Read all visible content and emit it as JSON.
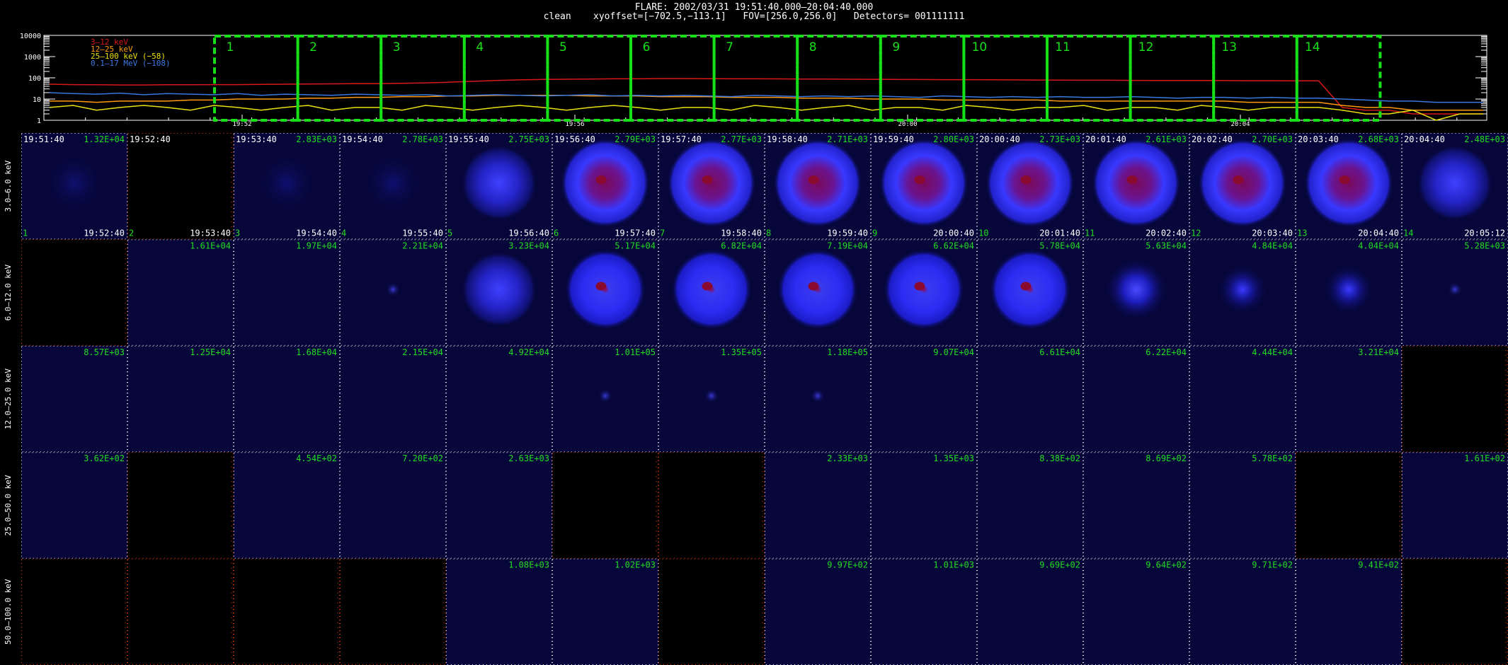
{
  "header": {
    "line1": "FLARE: 2002/03/31 19:51:40.000–20:04:40.000",
    "line2": "clean    xyoffset=[−702.5,−113.1]   FOV=[256.0,256.0]   Detectors= 001111111"
  },
  "colors": {
    "band1": "#d81818",
    "band2": "#ff9a10",
    "band3": "#e8e010",
    "band4": "#3a78e0",
    "interval_box": "#18e018",
    "tick_white": "#ffffff",
    "tick_red": "#e84010",
    "label_green": "#22dd22",
    "empty_panel": "#000000",
    "map_background": "#06063a"
  },
  "chart_data": [
    {
      "type": "line",
      "yscale": "log",
      "yticks": [
        "10000",
        "1000",
        "100",
        "10",
        "1"
      ],
      "ylim": [
        1,
        10000
      ],
      "xtick_labels": [
        "19:52",
        "19:56",
        "20:00",
        "20:04"
      ],
      "legend_placement": "top-left",
      "series": [
        {
          "name": "3–12 keV",
          "color_key": "band1",
          "values": [
            50,
            48,
            47,
            46,
            46,
            47,
            47,
            48,
            48,
            49,
            50,
            51,
            52,
            53,
            53,
            55,
            58,
            62,
            68,
            75,
            80,
            84,
            86,
            88,
            90,
            90,
            92,
            92,
            91,
            90,
            90,
            89,
            88,
            87,
            86,
            85,
            84,
            83,
            82,
            82,
            81,
            80,
            79,
            78,
            77,
            77,
            76,
            75,
            75,
            75,
            74,
            73,
            73,
            72,
            72,
            4,
            3,
            3,
            2,
            2,
            2,
            2
          ]
        },
        {
          "name": "12–25 keV",
          "color_key": "band2",
          "values": [
            8,
            8,
            7,
            8,
            8,
            8,
            9,
            9,
            10,
            10,
            10,
            11,
            11,
            12,
            12,
            13,
            13,
            14,
            14,
            15,
            15,
            15,
            15,
            14,
            14,
            14,
            13,
            13,
            13,
            12,
            12,
            12,
            11,
            11,
            11,
            10,
            10,
            10,
            9,
            9,
            9,
            9,
            9,
            8,
            8,
            8,
            8,
            8,
            8,
            8,
            8,
            7,
            7,
            7,
            7,
            5,
            4,
            4,
            3,
            3,
            3,
            3
          ]
        },
        {
          "name": "25–100 keV (−58)",
          "color_key": "band3",
          "values": [
            4,
            5,
            3,
            4,
            5,
            4,
            3,
            5,
            4,
            3,
            4,
            5,
            3,
            4,
            4,
            3,
            5,
            4,
            3,
            4,
            5,
            4,
            3,
            4,
            5,
            4,
            3,
            4,
            4,
            3,
            5,
            4,
            3,
            4,
            5,
            3,
            4,
            4,
            3,
            5,
            4,
            3,
            4,
            4,
            5,
            3,
            4,
            4,
            3,
            5,
            4,
            3,
            4,
            4,
            4,
            3,
            2,
            2,
            3,
            1,
            2,
            2
          ]
        },
        {
          "name": "0.1–17 MeV (−108)",
          "color_key": "band4",
          "values": [
            20,
            18,
            17,
            19,
            16,
            18,
            17,
            16,
            18,
            15,
            17,
            16,
            15,
            17,
            16,
            15,
            16,
            14,
            15,
            16,
            15,
            14,
            15,
            16,
            14,
            15,
            14,
            15,
            14,
            13,
            15,
            14,
            13,
            14,
            13,
            14,
            13,
            12,
            14,
            13,
            12,
            13,
            12,
            13,
            12,
            12,
            13,
            12,
            11,
            12,
            12,
            11,
            12,
            11,
            11,
            10,
            9,
            8,
            8,
            7,
            7,
            7
          ]
        }
      ],
      "intervals": [
        "1",
        "2",
        "3",
        "4",
        "5",
        "6",
        "7",
        "8",
        "9",
        "10",
        "11",
        "12",
        "13",
        "14"
      ]
    },
    {
      "type": "heatmap",
      "row_labels": [
        "3.0–6.0 keV",
        "6.0–12.0 keV",
        "12.0–25.0 keV",
        "25.0–50.0 keV",
        "50.0–100.0 keV"
      ],
      "time_start": [
        "19:51:40",
        "19:52:40",
        "19:53:40",
        "19:54:40",
        "19:55:40",
        "19:56:40",
        "19:57:40",
        "19:58:40",
        "19:59:40",
        "20:00:40",
        "20:01:40",
        "20:02:40",
        "20:03:40",
        "20:04:40"
      ],
      "time_end": [
        "19:52:40",
        "19:53:40",
        "19:54:40",
        "19:55:40",
        "19:56:40",
        "19:57:40",
        "19:58:40",
        "19:59:40",
        "20:00:40",
        "20:01:40",
        "20:02:40",
        "20:03:40",
        "20:04:40",
        "20:05:12"
      ],
      "panel_numbers": [
        "1",
        "2",
        "3",
        "4",
        "5",
        "6",
        "7",
        "8",
        "9",
        "10",
        "11",
        "12",
        "13",
        "14"
      ],
      "max_values": [
        [
          "1.32E+04",
          "",
          "2.83E+03",
          "2.78E+03",
          "2.75E+03",
          "2.79E+03",
          "2.77E+03",
          "2.71E+03",
          "2.80E+03",
          "2.73E+03",
          "2.61E+03",
          "2.70E+03",
          "2.68E+03",
          "2.48E+03"
        ],
        [
          "",
          "1.61E+04",
          "1.97E+04",
          "2.21E+04",
          "3.23E+04",
          "5.17E+04",
          "6.82E+04",
          "7.19E+04",
          "6.62E+04",
          "5.78E+04",
          "5.63E+04",
          "4.84E+04",
          "4.04E+04",
          "5.28E+03"
        ],
        [
          "8.57E+03",
          "1.25E+04",
          "1.68E+04",
          "2.15E+04",
          "4.92E+04",
          "1.01E+05",
          "1.35E+05",
          "1.18E+05",
          "9.07E+04",
          "6.61E+04",
          "6.22E+04",
          "4.44E+04",
          "3.21E+04",
          ""
        ],
        [
          "3.62E+02",
          "",
          "4.54E+02",
          "7.20E+02",
          "2.63E+03",
          "",
          "",
          "2.33E+03",
          "1.35E+03",
          "8.38E+02",
          "8.69E+02",
          "5.78E+02",
          "",
          "1.61E+02"
        ],
        [
          "",
          "",
          "",
          "",
          "1.08E+03",
          "1.02E+03",
          "",
          "9.97E+02",
          "1.01E+03",
          "9.69E+02",
          "9.64E+02",
          "9.71E+02",
          "9.41E+02",
          ""
        ]
      ],
      "source_kind": [
        [
          "faint",
          "empty",
          "faint",
          "faint",
          "noisy",
          "big",
          "big",
          "big",
          "big",
          "big",
          "big",
          "big",
          "big",
          "noisy"
        ],
        [
          "empty",
          "none",
          "none",
          "tiny",
          "noisy",
          "ring",
          "ring",
          "ring",
          "ring",
          "ring",
          "mid",
          "small",
          "small",
          "tiny"
        ],
        [
          "none",
          "none",
          "none",
          "none",
          "none",
          "tiny",
          "tiny",
          "tiny",
          "none",
          "none",
          "none",
          "none",
          "none",
          "empty"
        ],
        [
          "none",
          "empty",
          "none",
          "none",
          "none",
          "empty",
          "empty",
          "none",
          "none",
          "none",
          "none",
          "none",
          "empty",
          "none"
        ],
        [
          "empty",
          "empty",
          "empty",
          "empty",
          "none",
          "none",
          "empty",
          "none",
          "none",
          "none",
          "none",
          "none",
          "none",
          "empty"
        ]
      ]
    }
  ]
}
